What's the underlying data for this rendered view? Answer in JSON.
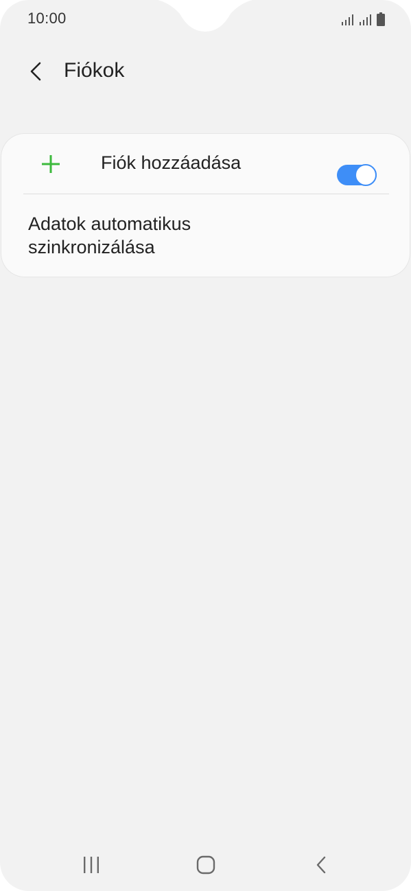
{
  "status_bar": {
    "time": "10:00",
    "icons": [
      "signal-icon",
      "signal-icon",
      "battery-icon"
    ]
  },
  "header": {
    "back_icon": "back-arrow-icon",
    "title": "Fiókok"
  },
  "card": {
    "add_account": {
      "icon": "plus-icon",
      "label": "Fiók hozzáadása",
      "icon_color": "#3cb93c"
    },
    "auto_sync": {
      "label_line1": "Adatok automatikus",
      "label_line2": "szinkronizálása",
      "enabled": true,
      "accent_color": "#3e8ef7"
    }
  },
  "nav_bar": {
    "items": [
      "recent-apps-icon",
      "home-icon",
      "back-icon"
    ]
  }
}
